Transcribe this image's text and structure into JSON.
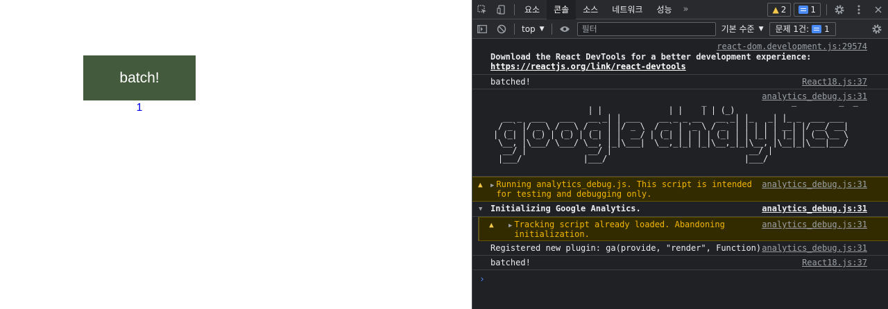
{
  "page": {
    "button_label": "batch!",
    "counter_value": "1"
  },
  "devtools": {
    "tabs": [
      "요소",
      "콘솔",
      "소스",
      "네트워크",
      "성능"
    ],
    "active_tab": "콘솔",
    "more_tabs": "»",
    "warning_count": "2",
    "message_count": "1",
    "toolbar": {
      "context": "top",
      "filter_placeholder": "필터",
      "levels": "기본 수준",
      "issues_label": "문제 1건:",
      "issues_count": "1"
    },
    "console": {
      "row1_src": "react-dom.development.js:29574",
      "row1_text": "Download the React DevTools for a better development experience: ",
      "row1_link": "https://reactjs.org/link/react-devtools",
      "row2_text": "batched!",
      "row2_src": "React18.js:37",
      "row3_src": "analytics_debug.js:31",
      "ascii_art": "                                            _                  _         _  _\n                    | |              | |    | | (_)\n  __ _  ___   ___   __ _| | ___    __ _ _ __   __ _| |_   _| |_ _  ___ ___\n / _` |/ _ \\ / _ \\ / _` | |/ _ \\  / _` | '_ \\ / _` | | | | | __| |/ __/ __|\n| (_| | (_) | (_) | (_| | |  __/ | (_| | | | | (_| | | |_| | |_| | (__\\__ \\\n \\__, |\\___/ \\___/ \\__, |_|\\___|  \\__,_|_| |_|\\__,_|_|\\__, |\\__|_|\\___|___/\n  __/ |             __/ |                             __/ |\n |___/             |___/                             |___/",
      "row4_text": "Running analytics_debug.js. This script is intended for testing and debugging only.",
      "row4_src": "analytics_debug.js:31",
      "row5_text": "Initializing Google Analytics.",
      "row5_src": "analytics_debug.js:31",
      "row6_text": "Tracking script already loaded. Abandoning initialization.",
      "row6_src": "analytics_debug.js:31",
      "row7_text": "Registered new plugin: ga(provide, \"render\", Function)",
      "row7_src": "analytics_debug.js:31",
      "row8_text": "batched!",
      "row8_src": "React18.js:37",
      "prompt": "›"
    }
  }
}
